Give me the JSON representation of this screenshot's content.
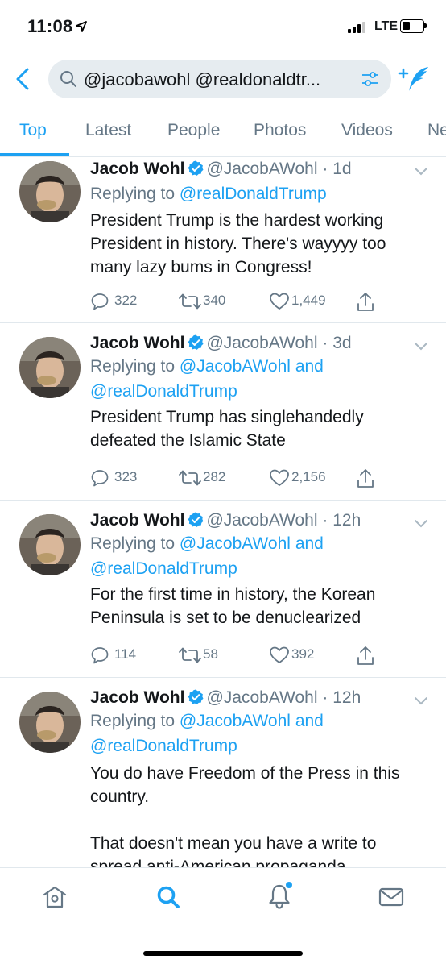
{
  "status_bar": {
    "time": "11:08",
    "network": "LTE"
  },
  "search": {
    "query": "@jacobawohl @realdonaldtr..."
  },
  "tabs": [
    "Top",
    "Latest",
    "People",
    "Photos",
    "Videos",
    "Ne"
  ],
  "colors": {
    "accent": "#1da1f2",
    "secondary_text": "#657786",
    "divider": "#e1e8ed"
  },
  "tweets": [
    {
      "name": "Jacob Wohl",
      "handle": "@JacobAWohl",
      "dot": "·",
      "time": "1d",
      "replying_prefix": "Replying to",
      "replying_to": "@realDonaldTrump",
      "replying_and": "",
      "replying_to_2": "",
      "text": "President Trump is the hardest working President in history. There's wayyyy too many lazy bums in Congress!",
      "replies": "322",
      "retweets": "340",
      "likes": "1,449"
    },
    {
      "name": "Jacob Wohl",
      "handle": "@JacobAWohl",
      "dot": "·",
      "time": "3d",
      "replying_prefix": "Replying to",
      "replying_to": "@JacobAWohl",
      "replying_and": "and",
      "replying_to_2": "@realDonaldTrump",
      "text": "President Trump has singlehandedly defeated the Islamic State",
      "replies": "323",
      "retweets": "282",
      "likes": "2,156"
    },
    {
      "name": "Jacob Wohl",
      "handle": "@JacobAWohl",
      "dot": "·",
      "time": "12h",
      "replying_prefix": "Replying to",
      "replying_to": "@JacobAWohl",
      "replying_and": "and",
      "replying_to_2": "@realDonaldTrump",
      "text": "For the first time in history, the Korean Peninsula is set to be denuclearized",
      "replies": "114",
      "retweets": "58",
      "likes": "392"
    },
    {
      "name": "Jacob Wohl",
      "handle": "@JacobAWohl",
      "dot": "·",
      "time": "12h",
      "replying_prefix": "Replying to",
      "replying_to": "@JacobAWohl",
      "replying_and": "and",
      "replying_to_2": "@realDonaldTrump",
      "text": "You do have Freedom of the Press in this country.\n\nThat doesn't mean you have a write to spread anti-American propaganda",
      "replies": "",
      "retweets": "",
      "likes": ""
    }
  ],
  "bottom_nav": {
    "icons": [
      "home-icon",
      "search-icon",
      "notifications-icon",
      "messages-icon"
    ],
    "notification_dot": true
  }
}
